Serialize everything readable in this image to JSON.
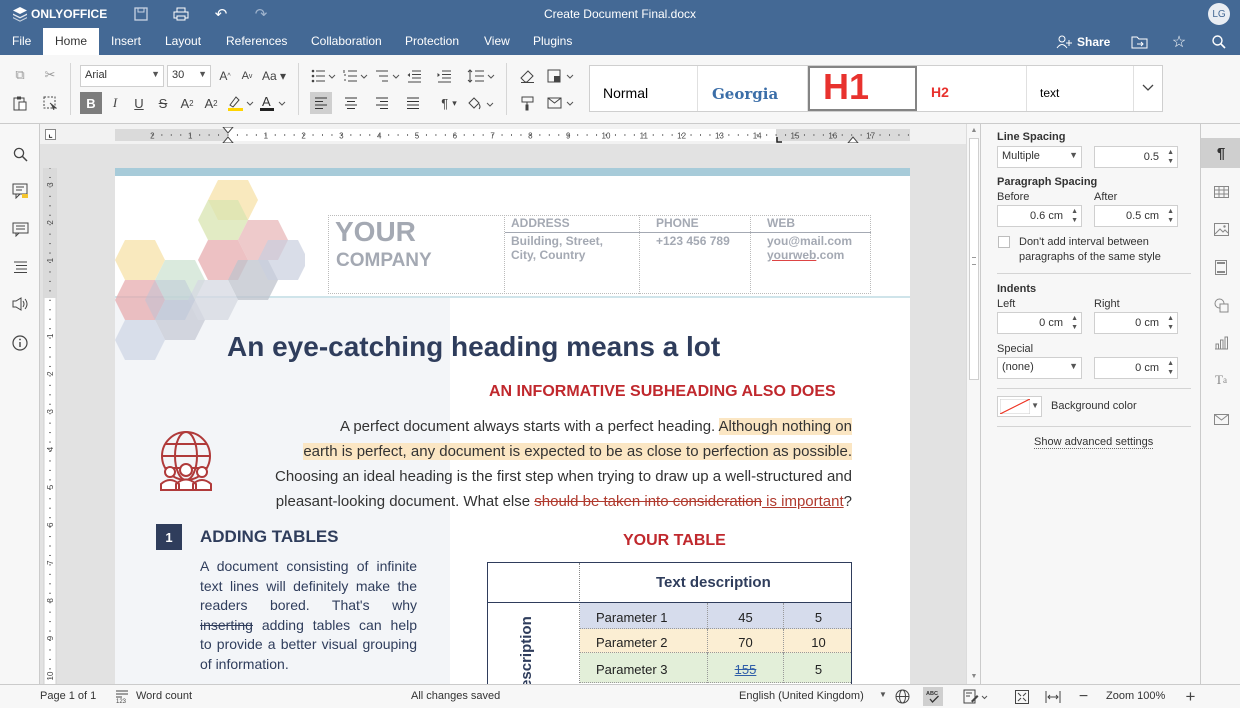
{
  "app": {
    "brand": "ONLYOFFICE",
    "doc_title": "Create Document Final.docx",
    "user_initials": "LG"
  },
  "menu": {
    "tabs": [
      "File",
      "Home",
      "Insert",
      "Layout",
      "References",
      "Collaboration",
      "Protection",
      "View",
      "Plugins"
    ],
    "active": "Home",
    "share_label": "Share"
  },
  "toolbar": {
    "font_name": "Arial",
    "font_size": "30",
    "styles": [
      "Normal",
      "Georgia",
      "H1",
      "H2",
      "text"
    ]
  },
  "ruler": {
    "h_ticks": [
      "2",
      "1",
      "1",
      "2",
      "3",
      "4",
      "5",
      "6",
      "7",
      "8",
      "9",
      "10",
      "11",
      "12",
      "13",
      "14",
      "15",
      "16",
      "17"
    ],
    "v_ticks": [
      "3",
      "2",
      "1",
      "1",
      "2",
      "3",
      "4",
      "5",
      "6",
      "7",
      "8",
      "9",
      "10"
    ]
  },
  "document": {
    "company": {
      "line1": "YOUR",
      "line2": "COMPANY"
    },
    "contact": {
      "address_label": "ADDRESS",
      "address_1": "Building, Street,",
      "address_2": "City, Country",
      "phone_label": "PHONE",
      "phone": "+123 456 789",
      "web_label": "WEB",
      "email": "you@mail.com",
      "web_a": "yourweb",
      "web_b": ".com"
    },
    "heading": "An eye-catching heading means a lot",
    "subheading": "AN INFORMATIVE SUBHEADING ALSO DOES",
    "para": {
      "p1": "A perfect document always starts with a perfect heading.",
      "hl1": "Although nothing on",
      "hl2": "earth is perfect, any document is expected to be as close to perfection as possible.",
      "p3": "Choosing an ideal heading is the first step when trying to draw up a well-structured and",
      "p4": "pleasant-looking document. What else",
      "struck": "should be taken into consideration",
      "inserted": " is important",
      "end": "?"
    },
    "section": {
      "number": "1",
      "title": "ADDING TABLES",
      "l1": "A document consisting of infinite",
      "l2": "text lines will definitely make the",
      "l3": "readers bored. That's why",
      "l4_struck": "inserting",
      "l4_rest": " adding tables can help",
      "l5": "to provide a better visual grouping",
      "l6": "of information."
    },
    "table": {
      "title": "YOUR TABLE",
      "header": "Text description",
      "side_label": "Text description",
      "rows": [
        {
          "name": "Parameter 1",
          "v1": "45",
          "v2": "5",
          "bg": "#d6dcec"
        },
        {
          "name": "Parameter 2",
          "v1": "70",
          "v2": "10",
          "bg": "#fbeed3"
        },
        {
          "name": "Parameter 3",
          "v1": "155",
          "v2": "5",
          "bg": "#e3efd9"
        }
      ]
    }
  },
  "panel": {
    "line_spacing_label": "Line Spacing",
    "line_spacing_mode": "Multiple",
    "line_spacing_value": "0.5",
    "paragraph_spacing_label": "Paragraph Spacing",
    "before_label": "Before",
    "before_value": "0.6 cm",
    "after_label": "After",
    "after_value": "0.5 cm",
    "no_interval_1": "Don't add interval between",
    "no_interval_2": "paragraphs of the same style",
    "indents_label": "Indents",
    "left_label": "Left",
    "left_value": "0 cm",
    "right_label": "Right",
    "right_value": "0 cm",
    "special_label": "Special",
    "special_value": "(none)",
    "special_amount": "0 cm",
    "bg_color_label": "Background color",
    "advanced_label": "Show advanced settings"
  },
  "status": {
    "page": "Page 1 of 1",
    "word_count": "Word count",
    "saved": "All changes saved",
    "language": "English (United Kingdom)",
    "zoom": "Zoom 100%"
  },
  "colors": {
    "brand": "#446995",
    "accent_red": "#c0282d",
    "heading": "#2f3d5c"
  }
}
